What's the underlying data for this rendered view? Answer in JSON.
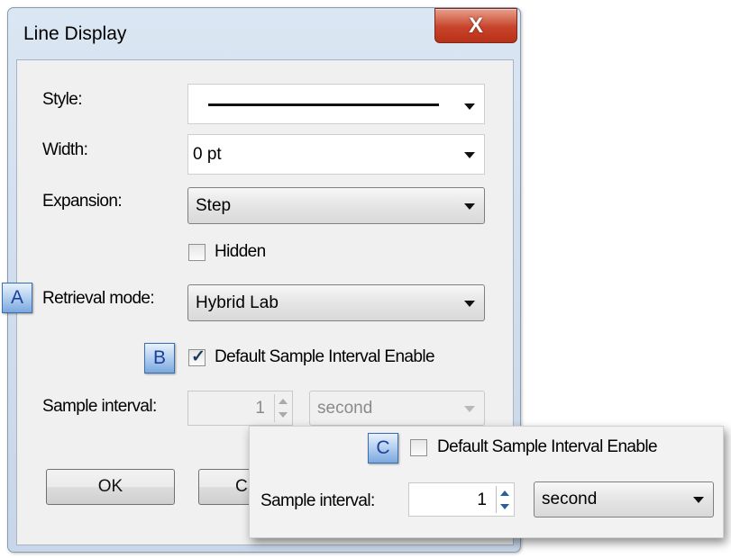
{
  "dialog": {
    "title": "Line Display",
    "close_icon": "close-x-icon",
    "close_glyph": "X"
  },
  "style": {
    "label": "Style:",
    "value": "solid-line"
  },
  "width": {
    "label": "Width:",
    "value": "0 pt"
  },
  "expansion": {
    "label": "Expansion:",
    "value": "Step"
  },
  "hidden": {
    "label": "Hidden",
    "checked": false
  },
  "retrieval": {
    "label": "Retrieval mode:",
    "value": "Hybrid Lab",
    "callout": "A"
  },
  "default_interval": {
    "label": "Default Sample Interval Enable",
    "checked": true,
    "callout": "B"
  },
  "sample_interval": {
    "label": "Sample interval:",
    "value": "1",
    "unit": "second",
    "enabled": false
  },
  "buttons": {
    "ok": "OK",
    "cancel_partial": "C"
  },
  "inset": {
    "callout": "C",
    "default_interval_label": "Default Sample Interval Enable",
    "default_interval_checked": false,
    "sample_interval_label": "Sample interval:",
    "sample_interval_value": "1",
    "unit": "second"
  },
  "colors": {
    "callout_text": "#1c3f9c",
    "close_button": "#c8432b",
    "checkmark": "#1e395b"
  }
}
